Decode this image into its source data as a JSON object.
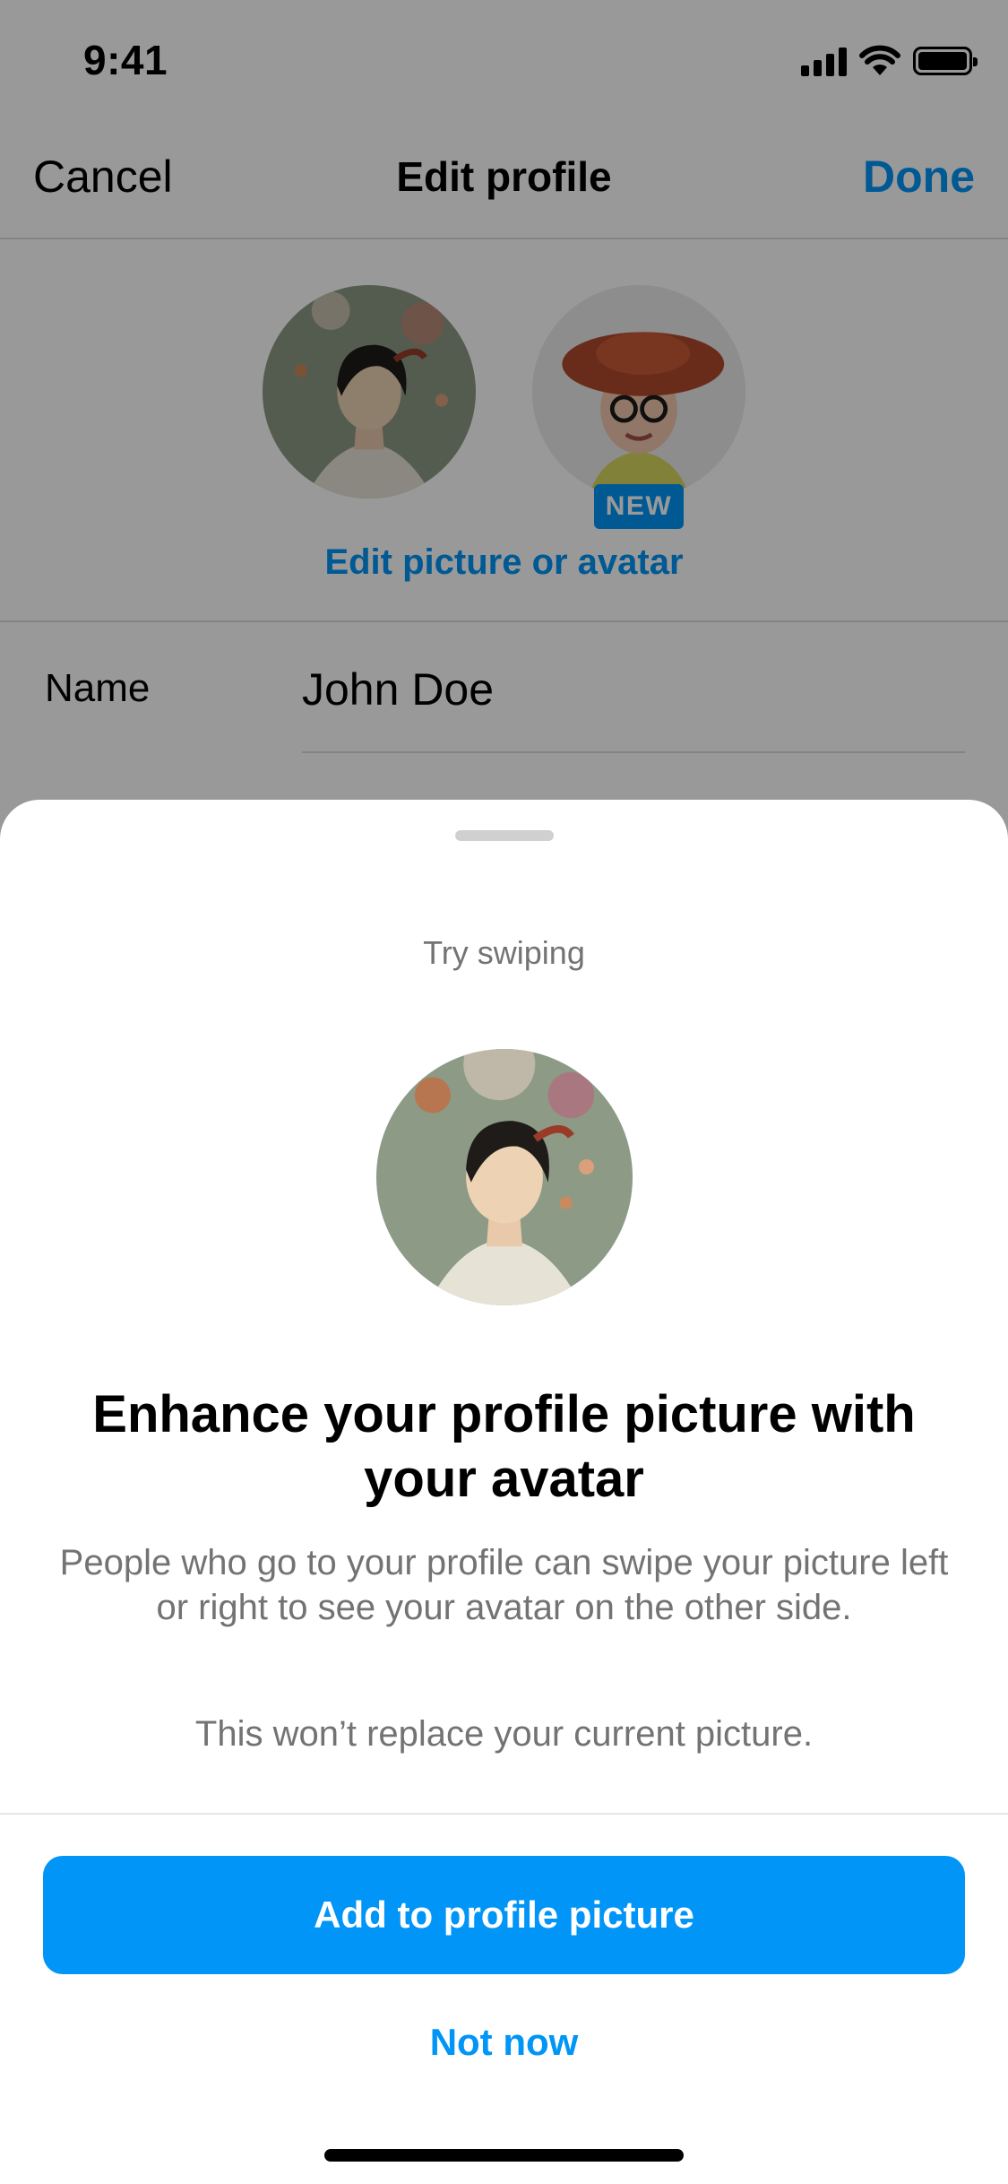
{
  "status_bar": {
    "time": "9:41",
    "icons": [
      "cellular-signal-icon",
      "wifi-icon",
      "battery-icon"
    ]
  },
  "nav": {
    "cancel_label": "Cancel",
    "title": "Edit profile",
    "done_label": "Done"
  },
  "profile_pictures": {
    "new_badge": "NEW",
    "edit_link": "Edit picture or avatar"
  },
  "form": {
    "name_label": "Name",
    "name_value": "John Doe"
  },
  "sheet": {
    "hint": "Try swiping",
    "headline": "Enhance your profile picture with your avatar",
    "body": "People who go to your profile can swipe your picture left or right to see your avatar on the other side.",
    "note": "This won’t replace your current picture.",
    "primary_button": "Add to profile picture",
    "secondary_button": "Not now"
  },
  "colors": {
    "accent": "#0095f6",
    "dim_overlay": "rgba(0,0,0,0.4)",
    "secondary_text": "#737373"
  }
}
